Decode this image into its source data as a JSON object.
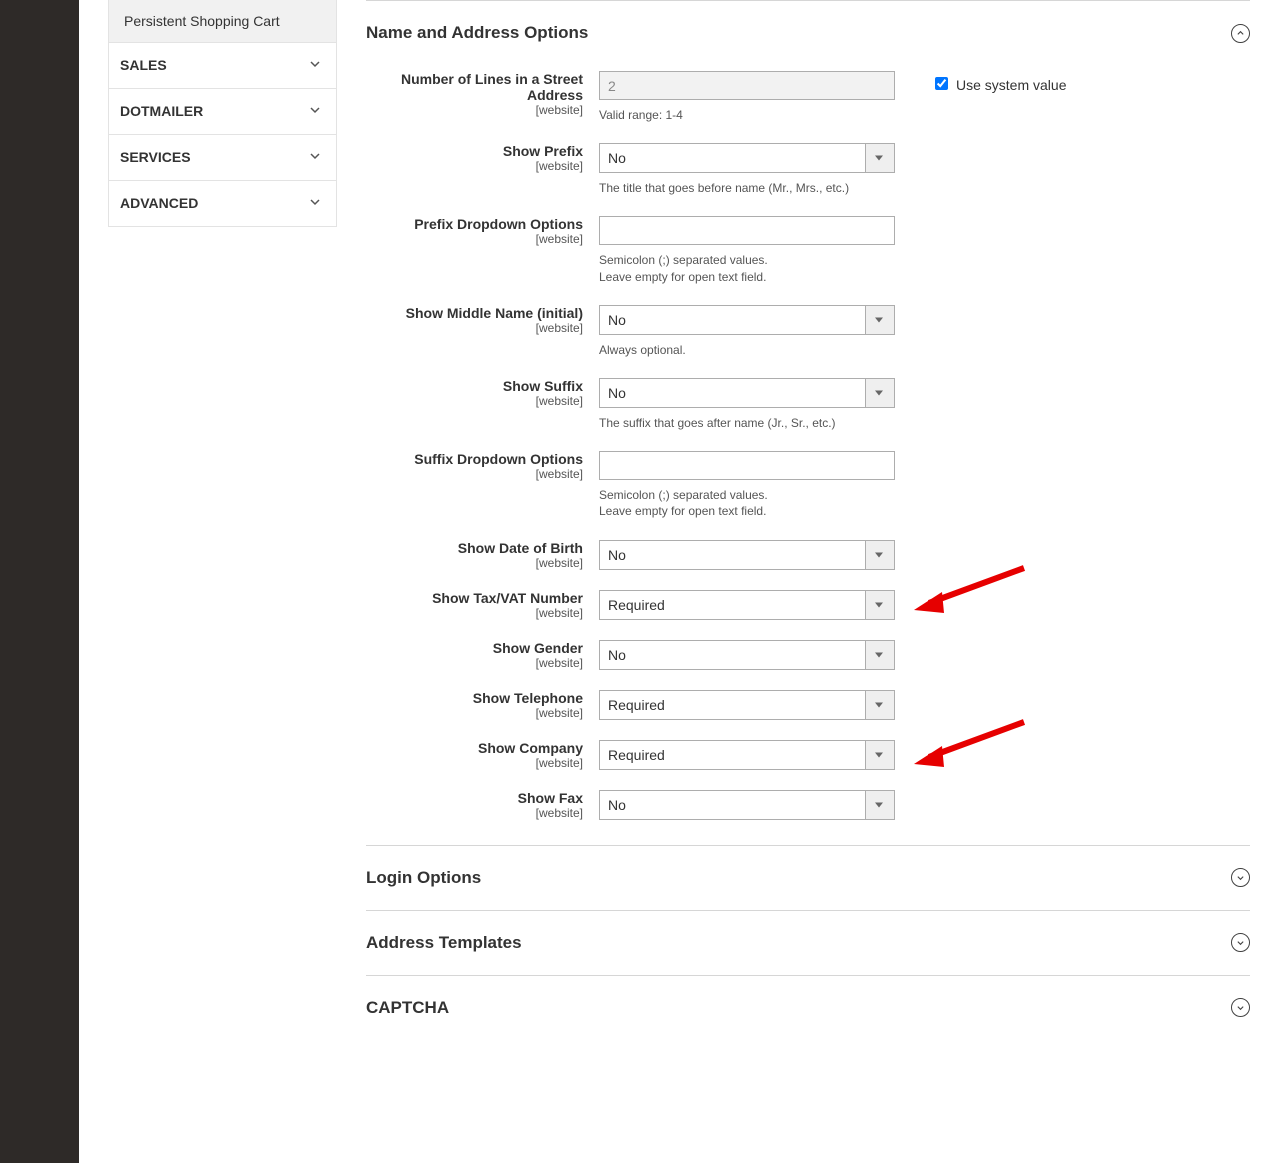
{
  "sidebar": {
    "sub_item": "Persistent Shopping Cart",
    "groups": [
      "SALES",
      "DOTMAILER",
      "SERVICES",
      "ADVANCED"
    ]
  },
  "sections": {
    "open": "Name and Address Options",
    "collapsed": [
      "Login Options",
      "Address Templates",
      "CAPTCHA"
    ]
  },
  "fields": {
    "num_lines": {
      "label": "Number of Lines in a Street Address",
      "scope": "[website]",
      "value": "2",
      "help": "Valid range: 1-4",
      "checkbox_label": "Use system value"
    },
    "show_prefix": {
      "label": "Show Prefix",
      "scope": "[website]",
      "value": "No",
      "help": "The title that goes before name (Mr., Mrs., etc.)"
    },
    "prefix_opts": {
      "label": "Prefix Dropdown Options",
      "scope": "[website]",
      "value": "",
      "help": "Semicolon (;) separated values.\nLeave empty for open text field."
    },
    "show_middle": {
      "label": "Show Middle Name (initial)",
      "scope": "[website]",
      "value": "No",
      "help": "Always optional."
    },
    "show_suffix": {
      "label": "Show Suffix",
      "scope": "[website]",
      "value": "No",
      "help": "The suffix that goes after name (Jr., Sr., etc.)"
    },
    "suffix_opts": {
      "label": "Suffix Dropdown Options",
      "scope": "[website]",
      "value": "",
      "help": "Semicolon (;) separated values.\nLeave empty for open text field."
    },
    "show_dob": {
      "label": "Show Date of Birth",
      "scope": "[website]",
      "value": "No"
    },
    "show_vat": {
      "label": "Show Tax/VAT Number",
      "scope": "[website]",
      "value": "Required"
    },
    "show_gender": {
      "label": "Show Gender",
      "scope": "[website]",
      "value": "No"
    },
    "show_tel": {
      "label": "Show Telephone",
      "scope": "[website]",
      "value": "Required"
    },
    "show_company": {
      "label": "Show Company",
      "scope": "[website]",
      "value": "Required"
    },
    "show_fax": {
      "label": "Show Fax",
      "scope": "[website]",
      "value": "No"
    }
  }
}
